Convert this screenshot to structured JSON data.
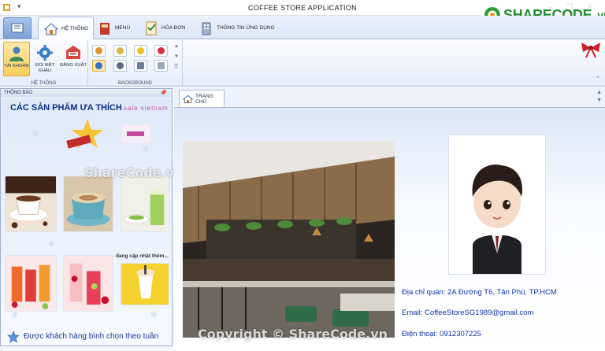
{
  "window": {
    "title": "COFFEE STORE APPLICATION",
    "controls": [
      "–",
      "❐",
      "✕"
    ]
  },
  "watermark": {
    "logo_text": "SHARECODE",
    "logo_tld": ".vn",
    "text_center": "ShareCode.vn",
    "text_bottom": "Copyright © ShareCode.vn"
  },
  "ribbon_tabs": [
    {
      "label": "HỆ THỐNG",
      "active": true
    },
    {
      "label": "MENU",
      "active": false
    },
    {
      "label": "HÓA ĐƠN",
      "active": false
    },
    {
      "label": "THÔNG TIN ỨNG DỤNG",
      "active": false
    }
  ],
  "ribbon": {
    "system_group": {
      "label": "HỆ THỐNG",
      "buttons": [
        {
          "label": "TÀI KHOẢN",
          "selected": true
        },
        {
          "label": "ĐỔI MẬT KHẨU",
          "selected": false
        },
        {
          "label": "ĐĂNG XUẤT",
          "selected": false
        }
      ]
    },
    "background_group": {
      "label": "BACKGROUND",
      "swatch_colors": [
        "#e0902a",
        "#d9b24a",
        "#f2c020",
        "#d83040",
        "#3a6fc6",
        "#5a6a80",
        "#6c7d99",
        "#9aa8bd"
      ]
    }
  },
  "left_panel": {
    "header": "THÔNG BÁO",
    "title": "CÁC SẢN PHẨM ƯA THÍCH",
    "title_scroll": "sale vietnam",
    "more_label": "đang cập nhật thêm...",
    "footer": "Được khách hàng bình chọn theo tuần"
  },
  "document": {
    "tab_label": "TRANG CHỦ",
    "address": "Địa chỉ quán: 2A Đường T6, Tân Phú, TP.HCM",
    "email": "Email: CoffeeStoreSG1989@gmail.com",
    "phone": "Điện thoại: 0912307225"
  }
}
